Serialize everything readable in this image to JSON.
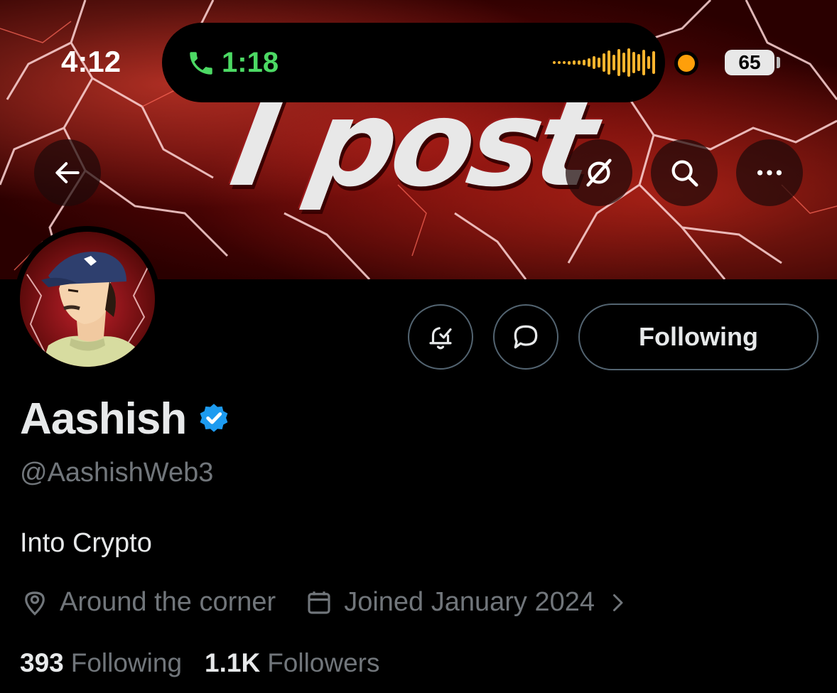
{
  "status_bar": {
    "time": "4:12",
    "call_duration": "1:18",
    "battery": "65"
  },
  "banner": {
    "text": "I post"
  },
  "header_actions": {
    "back": "arrow-left-icon",
    "grok": "grok-icon",
    "search": "search-icon",
    "more": "more-icon"
  },
  "profile": {
    "name": "Aashish",
    "handle": "@AashishWeb3",
    "bio": "Into Crypto",
    "location": "Around the corner",
    "joined": "Joined January 2024",
    "following_count": "393",
    "following_label": "Following",
    "followers_count": "1.1K",
    "followers_label": "Followers",
    "verified": true
  },
  "actions": {
    "follow_button": "Following",
    "notify": "bell-check-icon",
    "message": "message-icon"
  },
  "colors": {
    "background": "#000000",
    "secondary_text": "#71767b",
    "verified_blue": "#1d9bf0",
    "call_green": "#4cd964",
    "wave_orange": "#ffb52e"
  }
}
